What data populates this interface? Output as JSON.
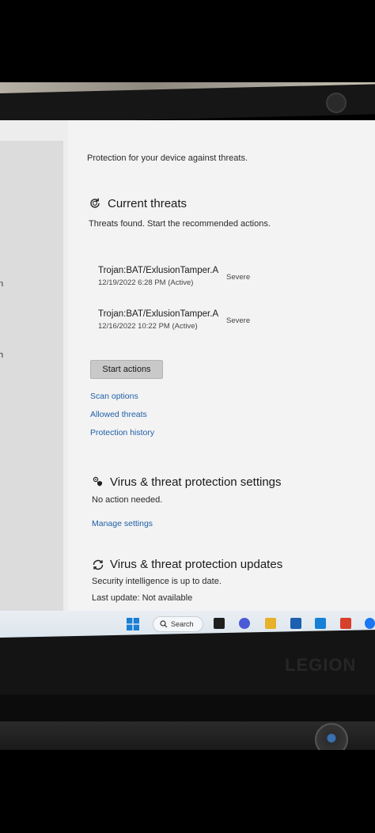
{
  "page": {
    "intro": "Protection for your device against threats."
  },
  "sidebar": {
    "fragment_1": "n",
    "fragment_2": "h"
  },
  "current_threats": {
    "icon": "refresh-shield-icon",
    "title": "Current threats",
    "subtitle": "Threats found. Start the recommended actions.",
    "threats": [
      {
        "name": "Trojan:BAT/ExlusionTamper.A",
        "meta": "12/19/2022 6:28 PM (Active)",
        "severity": "Severe"
      },
      {
        "name": "Trojan:BAT/ExlusionTamper.A",
        "meta": "12/16/2022 10:22 PM (Active)",
        "severity": "Severe"
      }
    ],
    "start_button": "Start actions",
    "links": [
      "Scan options",
      "Allowed threats",
      "Protection history"
    ]
  },
  "settings": {
    "icon": "gear-shield-icon",
    "title": "Virus & threat protection settings",
    "status": "No action needed.",
    "link": "Manage settings"
  },
  "updates": {
    "icon": "update-shield-icon",
    "title": "Virus & threat protection updates",
    "status": "Security intelligence is up to date.",
    "last_update": "Last update: Not available"
  },
  "taskbar": {
    "search_label": "Search",
    "icons": [
      "windows-start-icon",
      "search-icon",
      "task-view-icon",
      "chat-icon",
      "file-explorer-icon",
      "mail-icon",
      "app-l-icon",
      "office-icon",
      "facebook-icon"
    ]
  },
  "laptop": {
    "brand": "LEGION"
  }
}
